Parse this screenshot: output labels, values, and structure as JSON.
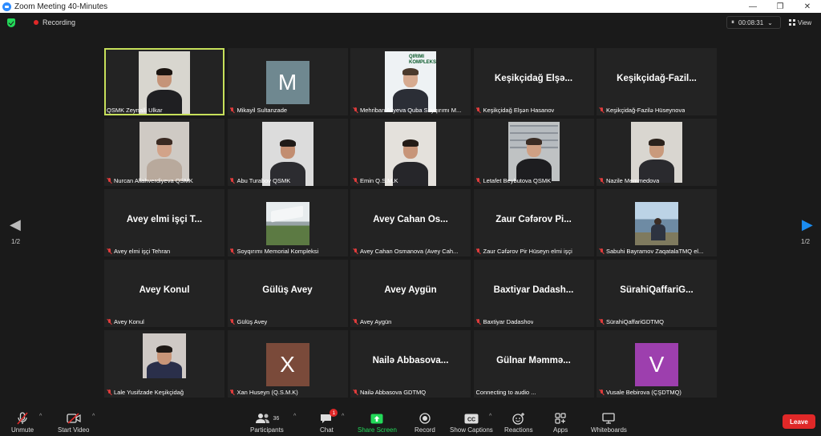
{
  "window": {
    "title": "Zoom Meeting 40-Minutes",
    "controls": [
      "—",
      "❐",
      "✕"
    ]
  },
  "topbar": {
    "recording_label": "Recording",
    "timer": "00:08:31",
    "view_label": "View"
  },
  "pager": {
    "left": "1/2",
    "right": "1/2"
  },
  "tiles": [
    {
      "name": "QSMK Zeynalli Ulkar",
      "type": "video",
      "muted": false,
      "active": true,
      "bigname": ""
    },
    {
      "name": "Mikayil Sultanzade",
      "type": "avatar",
      "letter": "M",
      "avatar_color": "#6f8890",
      "muted": true,
      "bigname": ""
    },
    {
      "name": "Mehriban Aliyeva Quba Soyqırımı  M...",
      "type": "video",
      "muted": true,
      "bigname": "",
      "photo_caption": "QIRIMI\nKOMPLEKSİ"
    },
    {
      "name": "Keşikçidağ Elşən Hasanov",
      "type": "name",
      "muted": true,
      "bigname": "Keşikçidağ  Elşə..."
    },
    {
      "name": "Keşikçidağ-Fazilə Hüseynova",
      "type": "name",
      "muted": true,
      "bigname": "Keşikçidağ-Fazil..."
    },
    {
      "name": "Nurcan Allahverdiyeva QSMK",
      "type": "video",
      "muted": true,
      "bigname": ""
    },
    {
      "name": "Abu Turabov QSMK",
      "type": "video",
      "muted": true,
      "bigname": ""
    },
    {
      "name": "Emin Q.S.M.K",
      "type": "video",
      "muted": true,
      "bigname": ""
    },
    {
      "name": "Letafet Beybutova QSMK",
      "type": "video",
      "muted": true,
      "bigname": ""
    },
    {
      "name": "Nazile Memmedova",
      "type": "video",
      "muted": true,
      "bigname": ""
    },
    {
      "name": "Avey elmi işçi Tehran",
      "type": "name",
      "muted": true,
      "bigname": "Avey  elmi  işçi  T..."
    },
    {
      "name": "Soyqırımı Memorial Kompleksi",
      "type": "video",
      "muted": true,
      "bigname": ""
    },
    {
      "name": "Avey Cahan Osmanova (Avey Cah...",
      "type": "name",
      "muted": true,
      "bigname": "Avey  Cahan  Os..."
    },
    {
      "name": "Zaur Cəfərov Pir Hüseyn elmi işçi",
      "type": "name",
      "muted": true,
      "bigname": "Zaur  Cəfərov  Pi..."
    },
    {
      "name": "Sabuhi Bayramov ZaqatalaTMQ el...",
      "type": "video",
      "muted": true,
      "bigname": ""
    },
    {
      "name": "Avey Konul",
      "type": "name",
      "muted": true,
      "bigname": "Avey Konul"
    },
    {
      "name": "Gülüş Avey",
      "type": "name",
      "muted": true,
      "bigname": "Gülüş Avey"
    },
    {
      "name": "Avey Aygün",
      "type": "name",
      "muted": true,
      "bigname": "Avey Aygün"
    },
    {
      "name": "Baxtiyar Dadashov",
      "type": "name",
      "muted": true,
      "bigname": "Baxtiyar  Dadash..."
    },
    {
      "name": "SürahiQaffariGDTMQ",
      "type": "name",
      "muted": true,
      "bigname": "SürahiQaffariG..."
    },
    {
      "name": "Lale Yusifzade Keşikçidağ",
      "type": "video",
      "muted": true,
      "bigname": ""
    },
    {
      "name": "Xan Huseyn (Q.S.M.K)",
      "type": "avatar",
      "letter": "X",
      "avatar_color": "#7a4a3a",
      "muted": true,
      "bigname": ""
    },
    {
      "name": "Nailə Abbasova GDTMQ",
      "type": "name",
      "muted": true,
      "bigname": "Nailə  Abbasova..."
    },
    {
      "name": "Connecting to audio ...",
      "type": "name",
      "muted": false,
      "bigname": "Gülnar  Məmmə..."
    },
    {
      "name": "Vusale Bebirova (ÇŞDTMQ)",
      "type": "avatar",
      "letter": "V",
      "avatar_color": "#9d3fae",
      "muted": true,
      "bigname": ""
    }
  ],
  "toolbar": {
    "unmute": "Unmute",
    "start_video": "Start Video",
    "participants": "Participants",
    "participants_count": "36",
    "chat": "Chat",
    "chat_badge": "1",
    "share_screen": "Share Screen",
    "record": "Record",
    "show_captions": "Show Captions",
    "reactions": "Reactions",
    "apps": "Apps",
    "whiteboards": "Whiteboards",
    "leave": "Leave"
  },
  "colors": {
    "active_speaker": "#c7e05a",
    "share_green": "#23d959",
    "leave_red": "#e02828",
    "accent_blue": "#1b8cf0"
  }
}
